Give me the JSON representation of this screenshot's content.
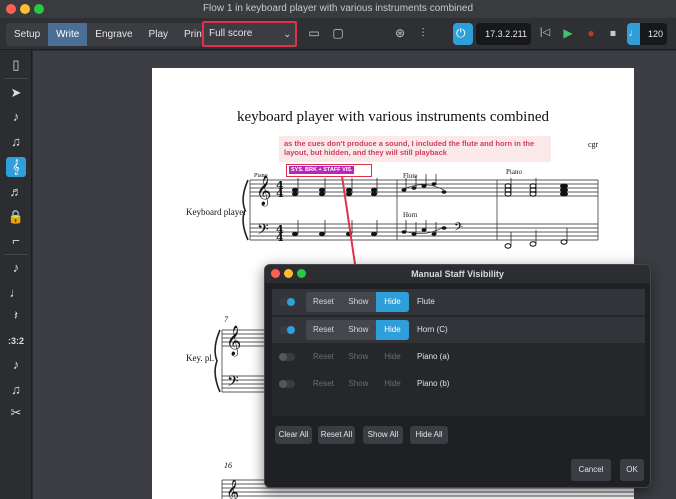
{
  "window": {
    "title": "Flow 1 in keyboard player with various instruments combined"
  },
  "toolbar": {
    "modes": [
      "Setup",
      "Write",
      "Engrave",
      "Play",
      "Print"
    ],
    "active_mode": "Write",
    "layout_select": "Full score",
    "counter": "17.3.2.211",
    "tempo": "120"
  },
  "score": {
    "title": "keyboard player with various instruments combined",
    "composer": "cgr",
    "annotation": "as the cues don't produce a sound, I included the flute and horn in the layout, but  hidden, and they will still playback",
    "signpost": "SYS. BRK + STAFF VIS.",
    "player_name": "Keyboard player",
    "player_abbrev": "Key. pl.",
    "cue_labels": {
      "piano_top": "Piano",
      "flute": "Flute",
      "piano_right": "Piano",
      "horn": "Horn"
    },
    "bar_numbers": [
      "7",
      "16"
    ]
  },
  "dialog": {
    "title": "Manual Staff Visibility",
    "rows": [
      {
        "instrument": "Flute",
        "reset": "Reset",
        "show": "Show",
        "hide": "Hide",
        "state": "hide",
        "enabled": true
      },
      {
        "instrument": "Horn (C)",
        "reset": "Reset",
        "show": "Show",
        "hide": "Hide",
        "state": "hide",
        "enabled": true
      },
      {
        "instrument": "Piano (a)",
        "reset": "Reset",
        "show": "Show",
        "hide": "Hide",
        "state": "none",
        "enabled": false
      },
      {
        "instrument": "Piano (b)",
        "reset": "Reset",
        "show": "Show",
        "hide": "Hide",
        "state": "none",
        "enabled": false
      }
    ],
    "buttons": {
      "clear_all": "Clear All",
      "reset_all": "Reset All",
      "show_all": "Show All",
      "hide_all": "Hide All",
      "cancel": "Cancel",
      "ok": "OK"
    }
  },
  "colors": {
    "accent": "#2e9fd8",
    "highlight_red": "#e0334a",
    "signpost": "#b728b8",
    "play_green": "#3cc36b"
  }
}
